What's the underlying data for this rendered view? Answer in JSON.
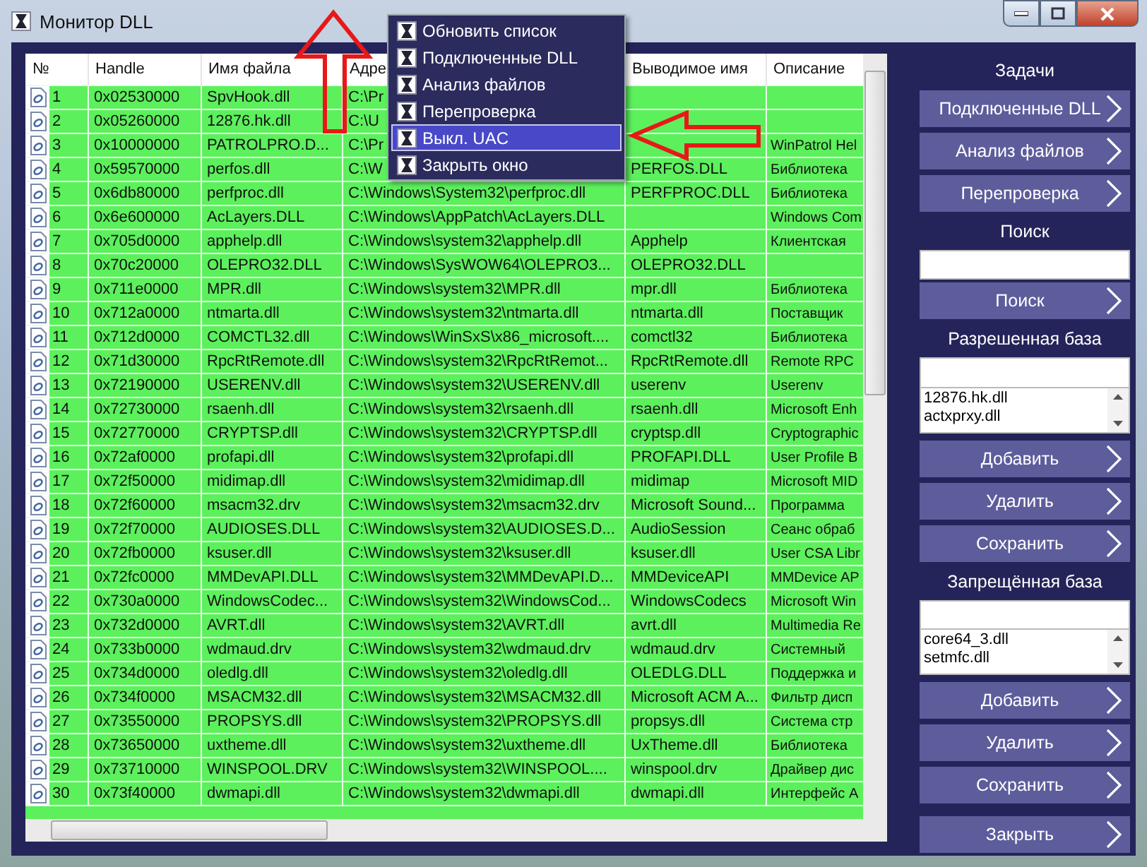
{
  "window": {
    "title": "Монитор DLL"
  },
  "table": {
    "columns": [
      "№",
      "Handle",
      "Имя файла",
      "Адре",
      "Выводимое имя",
      "Описание"
    ],
    "rows": [
      {
        "number": "1",
        "handle": "0x02530000",
        "file": "SpvHook.dll",
        "path": "C:\\Pr"
      },
      {
        "number": "2",
        "handle": "0x05260000",
        "file": "12876.hk.dll",
        "path": "C:\\U"
      },
      {
        "number": "3",
        "handle": "0x10000000",
        "file": "PATROLPRO.D...",
        "path": "C:\\Pr",
        "description": "WinPatrol Hel"
      },
      {
        "number": "4",
        "handle": "0x59570000",
        "file": "perfos.dll",
        "path": "C:\\W",
        "output_name": "PERFOS.DLL",
        "description": "Библиотека"
      },
      {
        "number": "5",
        "handle": "0x6db80000",
        "file": "perfproc.dll",
        "path": "C:\\Windows\\System32\\perfproc.dll",
        "output_name": "PERFPROC.DLL",
        "description": "Библиотека"
      },
      {
        "number": "6",
        "handle": "0x6e600000",
        "file": "AcLayers.DLL",
        "path": "C:\\Windows\\AppPatch\\AcLayers.DLL",
        "description": "Windows Com"
      },
      {
        "number": "7",
        "handle": "0x705d0000",
        "file": "apphelp.dll",
        "path": "C:\\Windows\\system32\\apphelp.dll",
        "output_name": "Apphelp",
        "description": "Клиентская"
      },
      {
        "number": "8",
        "handle": "0x70c20000",
        "file": "OLEPRO32.DLL",
        "path": "C:\\Windows\\SysWOW64\\OLEPRO3...",
        "output_name": "OLEPRO32.DLL"
      },
      {
        "number": "9",
        "handle": "0x711e0000",
        "file": "MPR.dll",
        "path": "C:\\Windows\\system32\\MPR.dll",
        "output_name": "mpr.dll",
        "description": "Библиотека"
      },
      {
        "number": "10",
        "handle": "0x712a0000",
        "file": "ntmarta.dll",
        "path": "C:\\Windows\\system32\\ntmarta.dll",
        "output_name": "ntmarta.dll",
        "description": "Поставщик"
      },
      {
        "number": "11",
        "handle": "0x712d0000",
        "file": "COMCTL32.dll",
        "path": "C:\\Windows\\WinSxS\\x86_microsoft....",
        "output_name": "comctl32",
        "description": "Библиотека"
      },
      {
        "number": "12",
        "handle": "0x71d30000",
        "file": "RpcRtRemote.dll",
        "path": "C:\\Windows\\system32\\RpcRtRemot...",
        "output_name": "RpcRtRemote.dll",
        "description": "Remote RPC"
      },
      {
        "number": "13",
        "handle": "0x72190000",
        "file": "USERENV.dll",
        "path": "C:\\Windows\\system32\\USERENV.dll",
        "output_name": "userenv",
        "description": "Userenv"
      },
      {
        "number": "14",
        "handle": "0x72730000",
        "file": "rsaenh.dll",
        "path": "C:\\Windows\\system32\\rsaenh.dll",
        "output_name": "rsaenh.dll",
        "description": "Microsoft Enh"
      },
      {
        "number": "15",
        "handle": "0x72770000",
        "file": "CRYPTSP.dll",
        "path": "C:\\Windows\\system32\\CRYPTSP.dll",
        "output_name": "cryptsp.dll",
        "description": "Cryptographic"
      },
      {
        "number": "16",
        "handle": "0x72af0000",
        "file": "profapi.dll",
        "path": "C:\\Windows\\system32\\profapi.dll",
        "output_name": "PROFAPI.DLL",
        "description": "User Profile B"
      },
      {
        "number": "17",
        "handle": "0x72f50000",
        "file": "midimap.dll",
        "path": "C:\\Windows\\system32\\midimap.dll",
        "output_name": "midimap",
        "description": "Microsoft MID"
      },
      {
        "number": "18",
        "handle": "0x72f60000",
        "file": "msacm32.drv",
        "path": "C:\\Windows\\system32\\msacm32.drv",
        "output_name": "Microsoft Sound...",
        "description": "Программа"
      },
      {
        "number": "19",
        "handle": "0x72f70000",
        "file": "AUDIOSES.DLL",
        "path": "C:\\Windows\\system32\\AUDIOSES.D...",
        "output_name": "AudioSession",
        "description": "Сеанс обраб"
      },
      {
        "number": "20",
        "handle": "0x72fb0000",
        "file": "ksuser.dll",
        "path": "C:\\Windows\\system32\\ksuser.dll",
        "output_name": "ksuser.dll",
        "description": "User CSA Libr"
      },
      {
        "number": "21",
        "handle": "0x72fc0000",
        "file": "MMDevAPI.DLL",
        "path": "C:\\Windows\\system32\\MMDevAPI.D...",
        "output_name": "MMDeviceAPI",
        "description": "MMDevice AP"
      },
      {
        "number": "22",
        "handle": "0x730a0000",
        "file": "WindowsCodec...",
        "path": "C:\\Windows\\system32\\WindowsCod...",
        "output_name": "WindowsCodecs",
        "description": "Microsoft Win"
      },
      {
        "number": "23",
        "handle": "0x732d0000",
        "file": "AVRT.dll",
        "path": "C:\\Windows\\system32\\AVRT.dll",
        "output_name": "avrt.dll",
        "description": "Multimedia Re"
      },
      {
        "number": "24",
        "handle": "0x733b0000",
        "file": "wdmaud.drv",
        "path": "C:\\Windows\\system32\\wdmaud.drv",
        "output_name": "wdmaud.drv",
        "description": "Системный"
      },
      {
        "number": "25",
        "handle": "0x734d0000",
        "file": "oledlg.dll",
        "path": "C:\\Windows\\system32\\oledlg.dll",
        "output_name": "OLEDLG.DLL",
        "description": "Поддержка и"
      },
      {
        "number": "26",
        "handle": "0x734f0000",
        "file": "MSACM32.dll",
        "path": "C:\\Windows\\system32\\MSACM32.dll",
        "output_name": "Microsoft ACM A...",
        "description": "Фильтр дисп"
      },
      {
        "number": "27",
        "handle": "0x73550000",
        "file": "PROPSYS.dll",
        "path": "C:\\Windows\\system32\\PROPSYS.dll",
        "output_name": "propsys.dll",
        "description": "Система стр"
      },
      {
        "number": "28",
        "handle": "0x73650000",
        "file": "uxtheme.dll",
        "path": "C:\\Windows\\system32\\uxtheme.dll",
        "output_name": "UxTheme.dll",
        "description": "Библиотека"
      },
      {
        "number": "29",
        "handle": "0x73710000",
        "file": "WINSPOOL.DRV",
        "path": "C:\\Windows\\system32\\WINSPOOL....",
        "output_name": "winspool.drv",
        "description": "Драйвер дис"
      },
      {
        "number": "30",
        "handle": "0x73f40000",
        "file": "dwmapi.dll",
        "path": "C:\\Windows\\system32\\dwmapi.dll",
        "output_name": "dwmapi.dll",
        "description": "Интерфейс А"
      }
    ]
  },
  "panel": [
    {
      "kind": "heading",
      "text": "Задачи"
    },
    {
      "kind": "button",
      "label": "Подключенные DLL"
    },
    {
      "kind": "button",
      "label": "Анализ файлов"
    },
    {
      "kind": "button",
      "label": "Перепроверка"
    },
    {
      "kind": "heading",
      "text": "Поиск"
    },
    {
      "kind": "field"
    },
    {
      "kind": "button",
      "label": "Поиск"
    },
    {
      "kind": "heading",
      "text": "Разрешенная база"
    },
    {
      "kind": "field"
    },
    {
      "kind": "list",
      "items": [
        "12876.hk.dll",
        "actxprxy.dll"
      ]
    },
    {
      "kind": "button",
      "label": "Добавить"
    },
    {
      "kind": "button",
      "label": "Удалить"
    },
    {
      "kind": "button",
      "label": "Сохранить"
    },
    {
      "kind": "heading",
      "text": "Запрещённая база"
    },
    {
      "kind": "field"
    },
    {
      "kind": "list",
      "items": [
        "core64_3.dll",
        "setmfc.dll"
      ]
    },
    {
      "kind": "button",
      "label": "Добавить"
    },
    {
      "kind": "button",
      "label": "Удалить"
    },
    {
      "kind": "button",
      "label": "Сохранить"
    },
    {
      "kind": "gap"
    },
    {
      "kind": "button",
      "label": "Закрыть"
    }
  ],
  "context_menu": {
    "items": [
      {
        "label": "Обновить список",
        "selected": false
      },
      {
        "label": "Подключенные DLL",
        "selected": false
      },
      {
        "label": "Анализ файлов",
        "selected": false
      },
      {
        "label": "Перепроверка",
        "selected": false
      },
      {
        "label": "Выкл. UAC",
        "selected": true
      },
      {
        "label": "Закрыть окно",
        "selected": false
      }
    ]
  },
  "annotations": [
    {
      "kind": "up_arrow"
    },
    {
      "kind": "left_arrow"
    }
  ]
}
